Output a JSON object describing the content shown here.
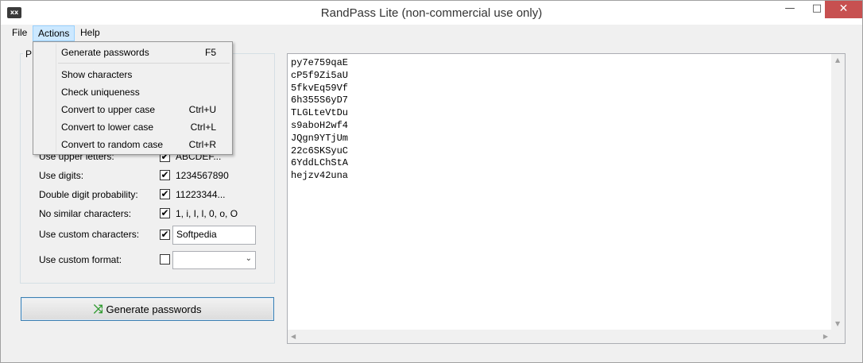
{
  "window": {
    "title": "RandPass Lite (non-commercial use only)",
    "icon_text": "xx",
    "controls": {
      "minimize": "—",
      "maximize": "□",
      "close": "✕"
    }
  },
  "menubar": {
    "file": "File",
    "actions": "Actions",
    "help": "Help"
  },
  "actions_menu": {
    "items": [
      {
        "label": "Generate passwords",
        "shortcut": "F5"
      },
      {
        "label": "Show characters",
        "shortcut": ""
      },
      {
        "label": "Check uniqueness",
        "shortcut": ""
      },
      {
        "label": "Convert to upper case",
        "shortcut": "Ctrl+U"
      },
      {
        "label": "Convert to lower case",
        "shortcut": "Ctrl+L"
      },
      {
        "label": "Convert to random case",
        "shortcut": "Ctrl+R"
      }
    ]
  },
  "options": {
    "group_label": "P",
    "upper_letters": {
      "label": "Use upper letters:",
      "checked": true,
      "value": "ABCDEF..."
    },
    "digits": {
      "label": "Use digits:",
      "checked": true,
      "value": "1234567890"
    },
    "double_digit": {
      "label": "Double digit probability:",
      "checked": true,
      "value": "11223344..."
    },
    "no_similar": {
      "label": "No similar characters:",
      "checked": true,
      "value": "1, i, I, l, 0, o, O"
    },
    "custom_chars": {
      "label": "Use custom characters:",
      "checked": true,
      "value": "Softpedia"
    },
    "custom_format": {
      "label": "Use custom format:",
      "checked": false,
      "value": ""
    }
  },
  "generate_button": {
    "label": "Generate passwords",
    "icon": "shuffle-icon"
  },
  "passwords": [
    "py7e759qaE",
    "cP5f9Zi5aU",
    "5fkvEq59Vf",
    "6h355S6yD7",
    "TLGLteVtDu",
    "s9aboH2wf4",
    "JQgn9YTjUm",
    "22c6SKSyuC",
    "6YddLChStA",
    "hejzv42una"
  ],
  "check_mark": "✔",
  "combo_arrow": "⌄"
}
